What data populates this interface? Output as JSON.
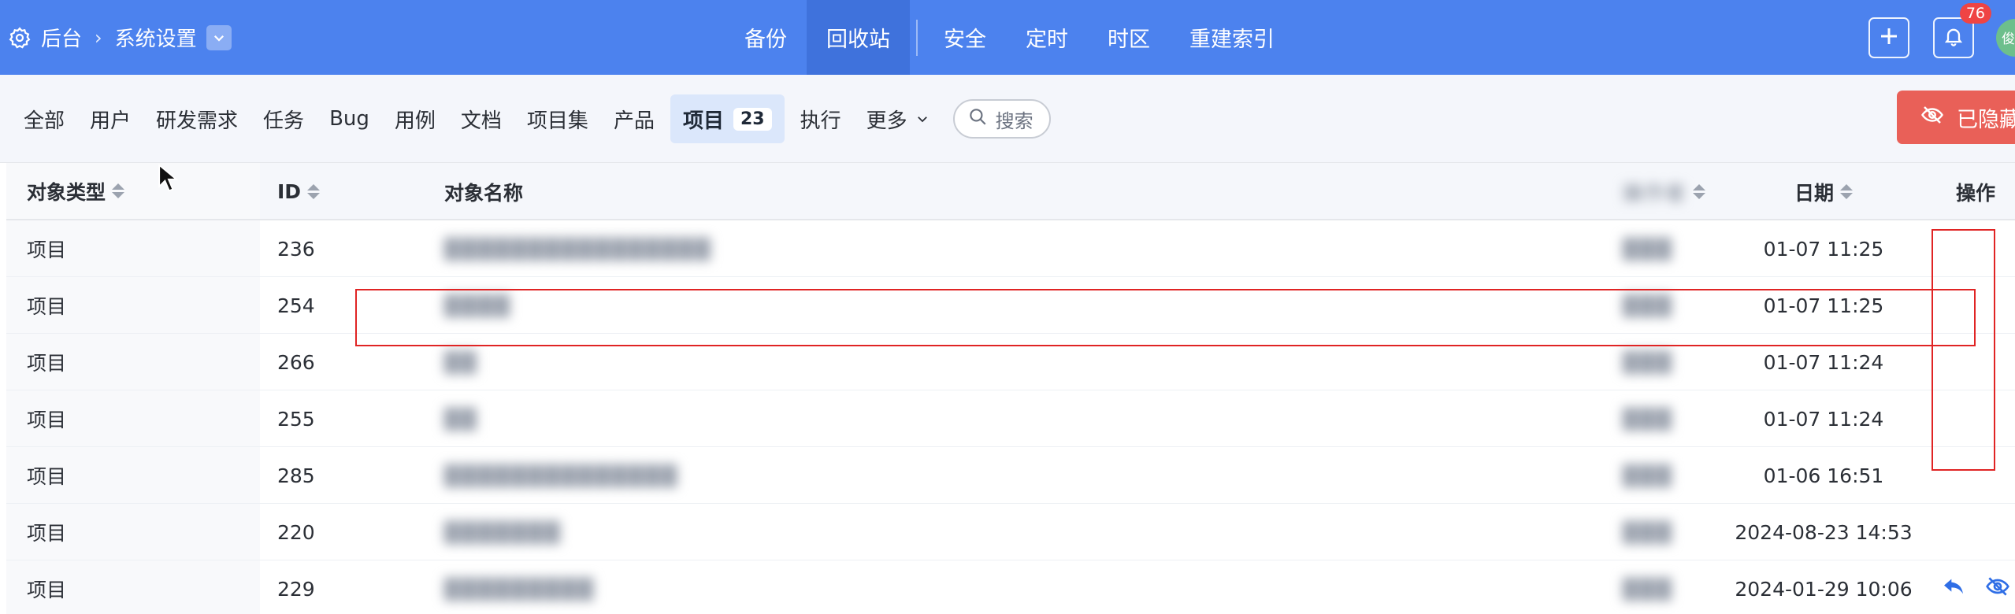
{
  "breadcrumb": {
    "root": "后台",
    "current": "系统设置"
  },
  "topnav": [
    {
      "label": "备份",
      "active": false
    },
    {
      "label": "回收站",
      "active": true
    },
    {
      "label": "安全",
      "active": false
    },
    {
      "label": "定时",
      "active": false
    },
    {
      "label": "时区",
      "active": false
    },
    {
      "label": "重建索引",
      "active": false
    }
  ],
  "header_right": {
    "notifications": "76",
    "avatar_text": "俊杰"
  },
  "filters": {
    "items": [
      "全部",
      "用户",
      "研发需求",
      "任务",
      "Bug",
      "用例",
      "文档",
      "项目集",
      "产品"
    ],
    "active_label": "项目",
    "active_count": "23",
    "after": "执行",
    "more": "更多",
    "search_placeholder": "搜索",
    "hidden_button": "已隐藏"
  },
  "table": {
    "columns": {
      "type": "对象类型",
      "id": "ID",
      "name": "对象名称",
      "operator": "操作者",
      "date": "日期",
      "actions": "操作"
    },
    "rows": [
      {
        "type": "项目",
        "id": "236",
        "name": "████████████████",
        "operator": "███",
        "date": "01-07 11:25"
      },
      {
        "type": "项目",
        "id": "254",
        "name": "████",
        "operator": "███",
        "date": "01-07 11:25"
      },
      {
        "type": "项目",
        "id": "266",
        "name": "██",
        "operator": "███",
        "date": "01-07 11:24"
      },
      {
        "type": "项目",
        "id": "255",
        "name": "██",
        "operator": "███",
        "date": "01-07 11:24"
      },
      {
        "type": "项目",
        "id": "285",
        "name": "██████████████",
        "operator": "███",
        "date": "01-06 16:51"
      },
      {
        "type": "项目",
        "id": "220",
        "name": "███████",
        "operator": "███",
        "date": "2024-08-23 14:53"
      },
      {
        "type": "项目",
        "id": "229",
        "name": "█████████",
        "operator": "███",
        "date": "2024-01-29 10:06"
      }
    ]
  },
  "colors": {
    "header_bg": "#4c82ee",
    "accent": "#2f6ee6",
    "danger": "#e96058",
    "annotation": "#e02424"
  }
}
